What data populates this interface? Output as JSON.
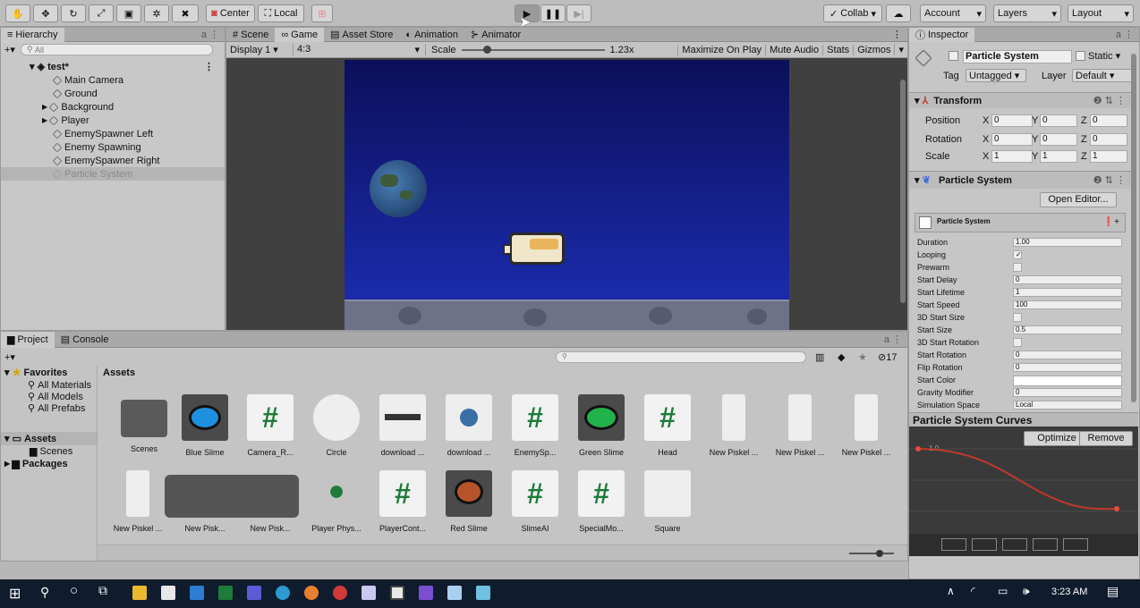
{
  "toolbar": {
    "center": "Center",
    "local": "Local",
    "collab": "Collab",
    "account": "Account",
    "layers": "Layers",
    "layout": "Layout"
  },
  "hierarchy": {
    "tab": "Hierarchy",
    "search_placeholder": "All",
    "scene": "test*",
    "items": [
      "Main Camera",
      "Ground",
      "Background",
      "Player",
      "EnemySpawner Left",
      "Enemy Spawning",
      "EnemySpawner Right",
      "Particle System"
    ]
  },
  "view_tabs": [
    "Scene",
    "Game",
    "Asset Store",
    "Animation",
    "Animator"
  ],
  "game_bar": {
    "display": "Display 1",
    "aspect": "4:3",
    "scale_label": "Scale",
    "scale_value": "1.23x",
    "maximize": "Maximize On Play",
    "mute": "Mute Audio",
    "stats": "Stats",
    "gizmos": "Gizmos"
  },
  "project": {
    "tabs": [
      "Project",
      "Console"
    ],
    "count": "17",
    "favorites": "Favorites",
    "fav_items": [
      "All Materials",
      "All Models",
      "All Prefabs"
    ],
    "assets_root": "Assets",
    "asset_folders": [
      "Scenes"
    ],
    "packages": "Packages",
    "breadcrumb": "Assets",
    "row1": [
      "Scenes",
      "Blue Slime",
      "Camera_R...",
      "Circle",
      "download ...",
      "download ...",
      "EnemySp...",
      "Green Slime",
      "Head",
      "New Piskel ...",
      "New Piskel ...",
      "New Piskel ..."
    ],
    "row2": [
      "New Piskel ...",
      "New Pisk...",
      "New Pisk...",
      "Player Phys...",
      "PlayerCont...",
      "Red Slime",
      "SlimeAI",
      "SpecialMo...",
      "Square"
    ]
  },
  "inspector": {
    "tab": "Inspector",
    "object_name": "Particle System",
    "static_label": "Static",
    "tag_label": "Tag",
    "tag_value": "Untagged",
    "layer_label": "Layer",
    "layer_value": "Default",
    "transform": {
      "title": "Transform",
      "rows": [
        {
          "label": "Position",
          "x": "0",
          "y": "0",
          "z": "0"
        },
        {
          "label": "Rotation",
          "x": "0",
          "y": "0",
          "z": "0"
        },
        {
          "label": "Scale",
          "x": "1",
          "y": "1",
          "z": "1"
        }
      ]
    },
    "ps_title": "Particle System",
    "open_editor": "Open Editor...",
    "ps_module_title": "Particle System",
    "ps_props": [
      {
        "label": "Duration",
        "value": "1.00"
      },
      {
        "label": "Looping",
        "value": "✓"
      },
      {
        "label": "Prewarm",
        "value": ""
      },
      {
        "label": "Start Delay",
        "value": "0"
      },
      {
        "label": "Start Lifetime",
        "value": "1"
      },
      {
        "label": "Start Speed",
        "value": "100"
      },
      {
        "label": "3D Start Size",
        "value": ""
      },
      {
        "label": "Start Size",
        "value": "0.5"
      },
      {
        "label": "3D Start Rotation",
        "value": ""
      },
      {
        "label": "Start Rotation",
        "value": "0"
      },
      {
        "label": "Flip Rotation",
        "value": "0"
      },
      {
        "label": "Start Color",
        "value": ""
      },
      {
        "label": "Gravity Modifier",
        "value": "0"
      },
      {
        "label": "Simulation Space",
        "value": "Local"
      }
    ],
    "curves_title": "Particle System Curves",
    "optimize": "Optimize",
    "remove": "Remove",
    "curve_label": "1.0"
  },
  "taskbar": {
    "time": "3:23 AM"
  }
}
